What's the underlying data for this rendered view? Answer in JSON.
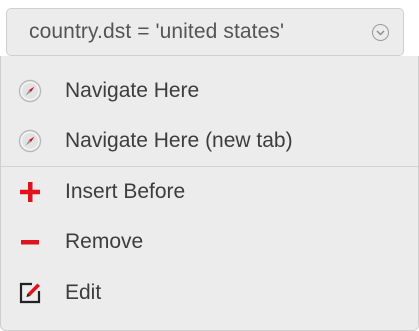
{
  "filter_chip": {
    "label": "country.dst = 'united states'",
    "caret_icon": "chevron-down-circle-icon"
  },
  "menu": {
    "navigate_items": [
      {
        "label": "Navigate Here",
        "icon": "compass-icon"
      },
      {
        "label": "Navigate Here (new tab)",
        "icon": "compass-icon"
      }
    ],
    "action_items": [
      {
        "label": "Insert Before",
        "icon": "plus-icon",
        "color": "#e0121b"
      },
      {
        "label": "Remove",
        "icon": "minus-icon",
        "color": "#e0121b"
      },
      {
        "label": "Edit",
        "icon": "edit-icon",
        "color": "#222222"
      }
    ]
  },
  "colors": {
    "accent_red": "#e0121b",
    "menu_bg": "#ececec",
    "text": "#3d3d3d"
  }
}
